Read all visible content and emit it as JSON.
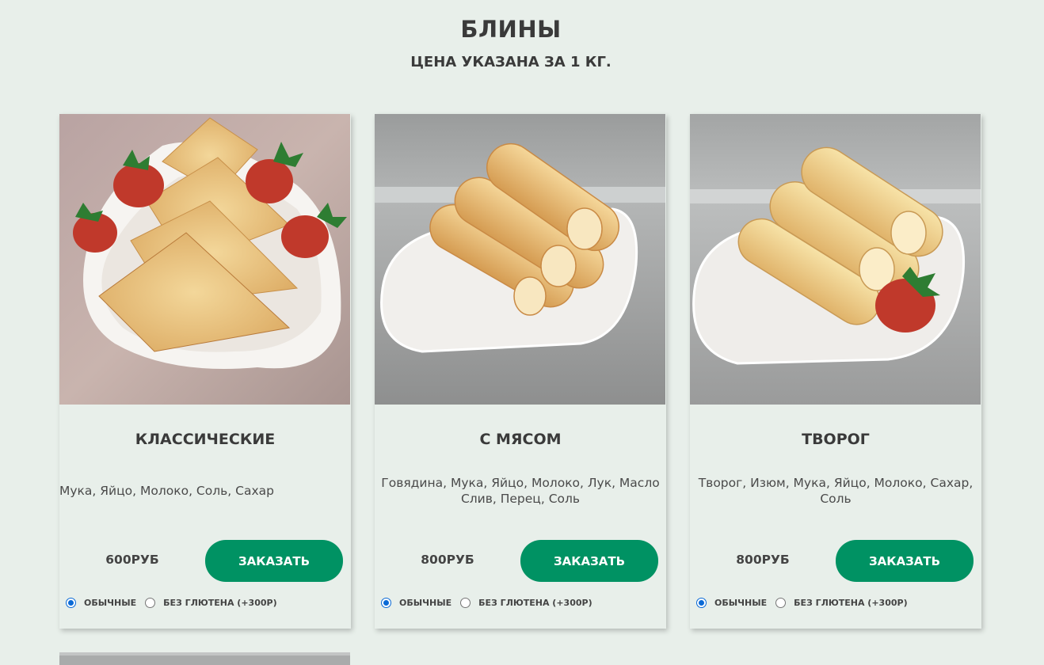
{
  "header": {
    "title": "БЛИНЫ",
    "subtitle": "ЦЕНА УКАЗАНА ЗА 1 КГ."
  },
  "cards": [
    {
      "title": "КЛАССИЧЕСКИЕ",
      "ingredients": "Мука, Яйцо, Молоко, Соль, Сахар",
      "price": "600РУБ",
      "button": "ЗАКАЗАТЬ",
      "option_regular": "ОБЫЧНЫЕ",
      "option_gluten_free": "БЕЗ ГЛЮТЕНА (+300Р)",
      "selected": "regular"
    },
    {
      "title": "С МЯСОМ",
      "ingredients": "Говядина, Мука, Яйцо, Молоко, Лук, Масло Слив, Перец, Соль",
      "price": "800РУБ",
      "button": "ЗАКАЗАТЬ",
      "option_regular": "ОБЫЧНЫЕ",
      "option_gluten_free": "БЕЗ ГЛЮТЕНА (+300Р)",
      "selected": "regular"
    },
    {
      "title": "ТВОРОГ",
      "ingredients": "Творог, Изюм, Мука, Яйцо, Молоко, Сахар, Соль",
      "price": "800РУБ",
      "button": "ЗАКАЗАТЬ",
      "option_regular": "ОБЫЧНЫЕ",
      "option_gluten_free": "БЕЗ ГЛЮТЕНА (+300Р)",
      "selected": "regular"
    }
  ],
  "colors": {
    "background": "#e8efea",
    "accent": "#009263",
    "radio_selected": "#0b6ad6"
  }
}
